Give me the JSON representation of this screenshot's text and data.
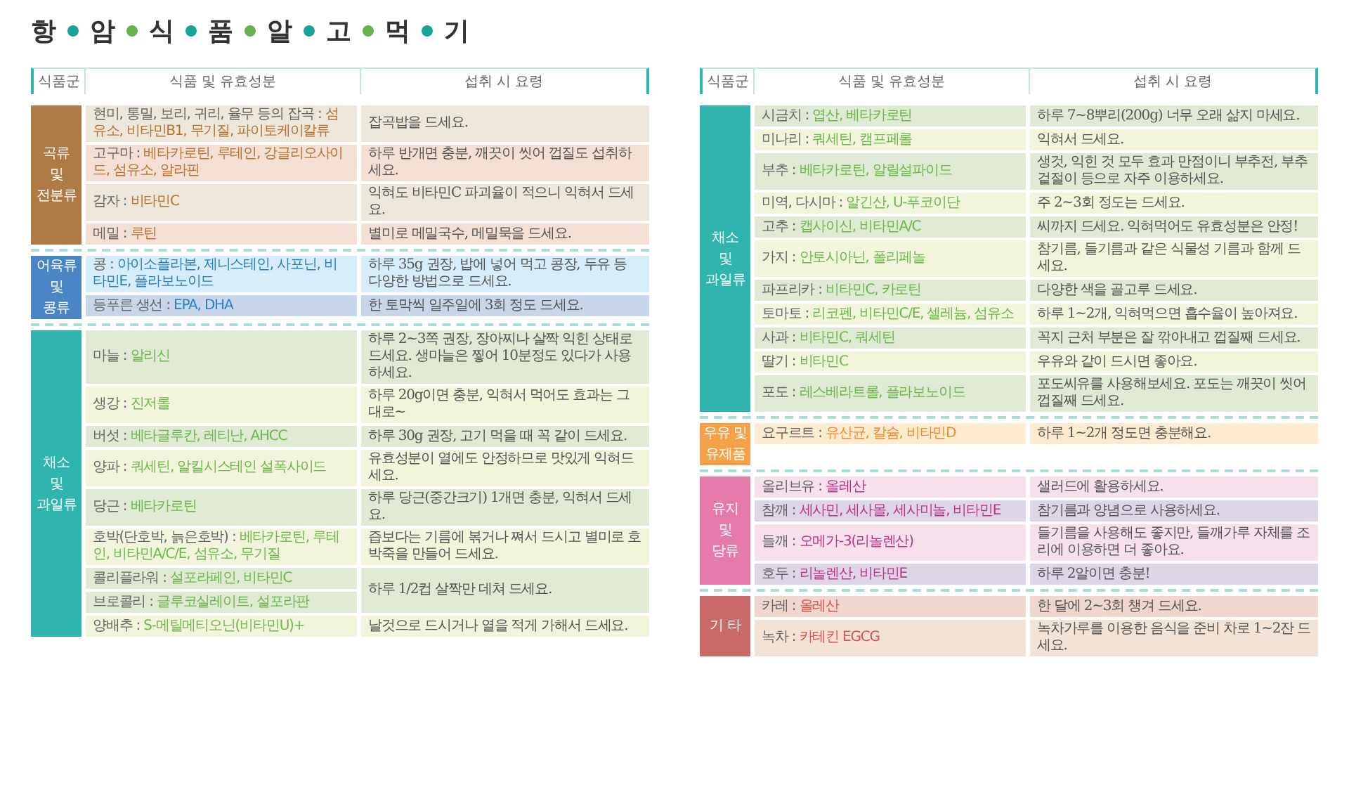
{
  "title": {
    "chars": [
      "항",
      "암",
      "식",
      "품",
      "알",
      "고",
      "먹",
      "기"
    ],
    "dots": [
      {
        "color": "#1aa39a"
      },
      {
        "color": "#6ab04c"
      },
      {
        "color": "#1aa39a"
      },
      {
        "color": "#6ab04c"
      },
      {
        "color": "#1aa39a"
      },
      {
        "color": "#6ab04c"
      },
      {
        "color": "#1aa39a"
      }
    ]
  },
  "tables": [
    {
      "columns": [
        "식품군",
        "식품 및 유효성분",
        "섭취 시 요령"
      ],
      "groups": [
        {
          "kind": "grain",
          "color": "#b07a45",
          "label_lines": [
            "곡류",
            "및",
            "전분류"
          ],
          "rows": [
            {
              "items": [
                {
                  "food": "현미, 통밀, 보리, 귀리, 율무 등의 잡곡 :",
                  "nutrients": "섬유소, 비타민B1, 무기질, 파이토케이칼류"
                }
              ],
              "tip": "잡곡밥을 드세요."
            },
            {
              "items": [
                {
                  "food": "고구마 :",
                  "nutrients": "베타카로틴, 루테인, 강글리오사이드, 섬유소, 알라핀"
                }
              ],
              "tip": "하루 반개면 충분, 깨끗이 씻어 껍질도 섭취하세요."
            },
            {
              "items": [
                {
                  "food": "감자 :",
                  "nutrients": "비타민C"
                }
              ],
              "tip": "익혀도 비타민C 파괴율이 적으니 익혀서 드세요."
            },
            {
              "items": [
                {
                  "food": "메밀 :",
                  "nutrients": "루틴"
                }
              ],
              "tip": "별미로 메밀국수, 메밀묵을 드세요."
            }
          ]
        },
        {
          "kind": "protein",
          "color": "#4a86c5",
          "label_lines": [
            "어육류",
            "및",
            "콩류"
          ],
          "rows": [
            {
              "items": [
                {
                  "food": "콩 :",
                  "nutrients": "아이소플라본, 제니스테인, 사포닌, 비타민E, 플라보노이드"
                }
              ],
              "tip": "하루 35g 권장, 밥에 넣어 먹고 콩장, 두유 등 다양한 방법으로 드세요."
            },
            {
              "items": [
                {
                  "food": "등푸른 생선 :",
                  "nutrients": "EPA, DHA"
                }
              ],
              "tip": "한 토막씩 일주일에 3회 정도 드세요."
            }
          ]
        },
        {
          "kind": "vegetable",
          "color": "#2fb5ad",
          "label_lines": [
            "채소",
            "및",
            "과일류"
          ],
          "rows": [
            {
              "items": [
                {
                  "food": "마늘 :",
                  "nutrients": "알리신"
                }
              ],
              "tip": "하루 2~3쪽 권장, 장아찌나 살짝 익힌 상태로 드세요. 생마늘은 찧어 10분정도 있다가 사용하세요."
            },
            {
              "items": [
                {
                  "food": "생강 :",
                  "nutrients": "진저롤"
                }
              ],
              "tip": "하루 20g이면 충분, 익혀서 먹어도 효과는 그대로~"
            },
            {
              "items": [
                {
                  "food": "버섯 :",
                  "nutrients": "베타글루칸, 레티난, AHCC"
                }
              ],
              "tip": "하루 30g 권장, 고기 먹을 때 꼭 같이 드세요."
            },
            {
              "items": [
                {
                  "food": "양파 :",
                  "nutrients": "쿼세틴, 알킬시스테인 설폭사이드"
                }
              ],
              "tip": "유효성분이 열에도 안정하므로 맛있게 익혀드세요."
            },
            {
              "items": [
                {
                  "food": "당근 :",
                  "nutrients": "베타카로틴"
                }
              ],
              "tip": "하루 당근(중간크기) 1개면 충분, 익혀서 드세요."
            },
            {
              "items": [
                {
                  "food": "호박(단호박, 늙은호박) :",
                  "nutrients": "베타카로틴, 루테인, 비타민A/C/E, 섬유소, 무기질"
                }
              ],
              "tip": "즙보다는 기름에 볶거나 쪄서 드시고 별미로 호박죽을 만들어 드세요."
            },
            {
              "items": [
                {
                  "food": "콜리플라워 :",
                  "nutrients": "설포라페인, 비타민C"
                },
                {
                  "food": "브로콜리 :",
                  "nutrients": "글루코실레이트, 설포라판"
                }
              ],
              "tip": "하루 1/2컵 살짝만 데쳐 드세요."
            },
            {
              "items": [
                {
                  "food": "양배추 :",
                  "nutrients": "S-메틸메티오닌(비타민U)+"
                }
              ],
              "tip": "날것으로 드시거나 열을 적게 가해서 드세요."
            }
          ]
        }
      ]
    },
    {
      "columns": [
        "식품군",
        "식품 및 유효성분",
        "섭취 시 요령"
      ],
      "groups": [
        {
          "kind": "vegetable",
          "color": "#2fb5ad",
          "label_lines": [
            "채소",
            "및",
            "과일류"
          ],
          "rows": [
            {
              "items": [
                {
                  "food": "시금치 :",
                  "nutrients": "엽산, 베타카로틴"
                }
              ],
              "tip": "하루 7~8뿌리(200g) 너무 오래 삶지 마세요."
            },
            {
              "items": [
                {
                  "food": "미나리 :",
                  "nutrients": "쿼세틴, 캠프페롤"
                }
              ],
              "tip": "익혀서 드세요."
            },
            {
              "items": [
                {
                  "food": "부추 :",
                  "nutrients": "베타카로틴, 알릴설파이드"
                }
              ],
              "tip": "생것, 익힌 것 모두 효과 만점이니 부추전, 부추 겉절이 등으로 자주 이용하세요."
            },
            {
              "items": [
                {
                  "food": "미역, 다시마 :",
                  "nutrients": "알긴산, U-푸코이단"
                }
              ],
              "tip": "주 2~3회 정도는 드세요."
            },
            {
              "items": [
                {
                  "food": "고추 :",
                  "nutrients": "캡사이신, 비타민A/C"
                }
              ],
              "tip": "씨까지 드세요. 익혀먹어도 유효성분은 안정!"
            },
            {
              "items": [
                {
                  "food": "가지 :",
                  "nutrients": "안토시아닌, 폴리페놀"
                }
              ],
              "tip": "참기름, 들기름과 같은 식물성 기름과 함께 드세요."
            },
            {
              "items": [
                {
                  "food": "파프리카 :",
                  "nutrients": "비타민C, 카로틴"
                }
              ],
              "tip": "다양한 색을 골고루 드세요."
            },
            {
              "items": [
                {
                  "food": "토마토 :",
                  "nutrients": "리코펜, 비타민C/E, 셀레늄, 섬유소"
                }
              ],
              "tip": "하루 1~2개, 익혀먹으면 흡수율이 높아져요."
            },
            {
              "items": [
                {
                  "food": "사과 :",
                  "nutrients": "비타민C, 쿼세틴"
                }
              ],
              "tip": "꼭지 근처 부분은 잘 깎아내고 껍질째 드세요."
            },
            {
              "items": [
                {
                  "food": "딸기 :",
                  "nutrients": "비타민C"
                }
              ],
              "tip": "우유와 같이 드시면 좋아요."
            },
            {
              "items": [
                {
                  "food": "포도 :",
                  "nutrients": "레스베라트롤, 플라보노이드"
                }
              ],
              "tip": "포도씨유를 사용해보세요. 포도는 깨끗이 씻어 껍질째 드세요."
            }
          ]
        },
        {
          "kind": "dairy",
          "color": "#f5a14a",
          "label_lines": [
            "우유 및",
            "유제품"
          ],
          "rows": [
            {
              "items": [
                {
                  "food": "요구르트 :",
                  "nutrients": "유산균, 칼슘, 비타민D"
                }
              ],
              "tip": "하루 1~2개 정도면 충분해요."
            }
          ]
        },
        {
          "kind": "fat",
          "color": "#e67aaa",
          "label_lines": [
            "유지",
            "및",
            "당류"
          ],
          "rows": [
            {
              "items": [
                {
                  "food": "올리브유 :",
                  "nutrients": "올레산"
                }
              ],
              "tip": "샐러드에 활용하세요."
            },
            {
              "items": [
                {
                  "food": "참깨 :",
                  "nutrients": "세사민, 세사몰, 세사미놀, 비타민E"
                }
              ],
              "tip": "참기름과 양념으로 사용하세요."
            },
            {
              "items": [
                {
                  "food": "들깨 :",
                  "nutrients": "오메가-3(리놀렌산)"
                }
              ],
              "tip": "들기름을 사용해도 좋지만, 들깨가루 자체를 조리에 이용하면 더 좋아요."
            },
            {
              "items": [
                {
                  "food": "호두 :",
                  "nutrients": "리놀렌산, 비타민E"
                }
              ],
              "tip": "하루 2알이면 충분!"
            }
          ]
        },
        {
          "kind": "other",
          "color": "#c96a6a",
          "label_lines": [
            "기 타"
          ],
          "rows": [
            {
              "items": [
                {
                  "food": "카레 :",
                  "nutrients": "올레산"
                }
              ],
              "tip": "한 달에 2~3회 챙겨 드세요."
            },
            {
              "items": [
                {
                  "food": "녹차 :",
                  "nutrients": "카테킨 EGCG"
                }
              ],
              "tip": "녹차가루를 이용한 음식을 준비 차로 1~2잔 드세요."
            }
          ]
        }
      ]
    }
  ]
}
